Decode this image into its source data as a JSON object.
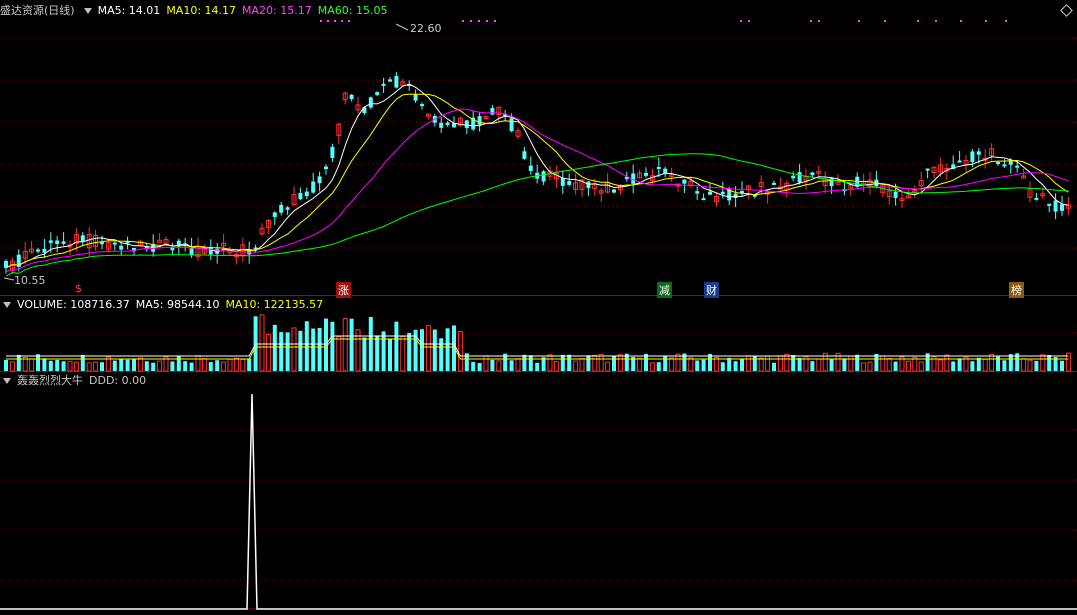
{
  "main_panel": {
    "stock_title": "盛达资源(日线)",
    "ma5_label": "MA5: 14.01",
    "ma10_label": "MA10: 14.17",
    "ma20_label": "MA20: 15.17",
    "ma60_label": "MA60: 15.05",
    "high_label": "22.60",
    "low_label": "10.55",
    "event_tags": [
      "$",
      "涨",
      "减",
      "财",
      "榜"
    ]
  },
  "volume_panel": {
    "volume_label": "VOLUME: 108716.37",
    "ma5_label": "MA5: 98544.10",
    "ma10_label": "MA10: 122135.57"
  },
  "indicator_panel": {
    "title": "轰轰烈烈大牛",
    "ddd_label": "DDD: 0.00"
  },
  "colors": {
    "ma5": "#ffffff",
    "ma10": "#ffff00",
    "ma20": "#ff00ff",
    "ma60": "#00ff00",
    "up": "#ff3232",
    "down": "#54ffff",
    "grid": "#800000"
  },
  "icons": [
    "collapse-triangle-icon",
    "diamond-icon"
  ]
}
